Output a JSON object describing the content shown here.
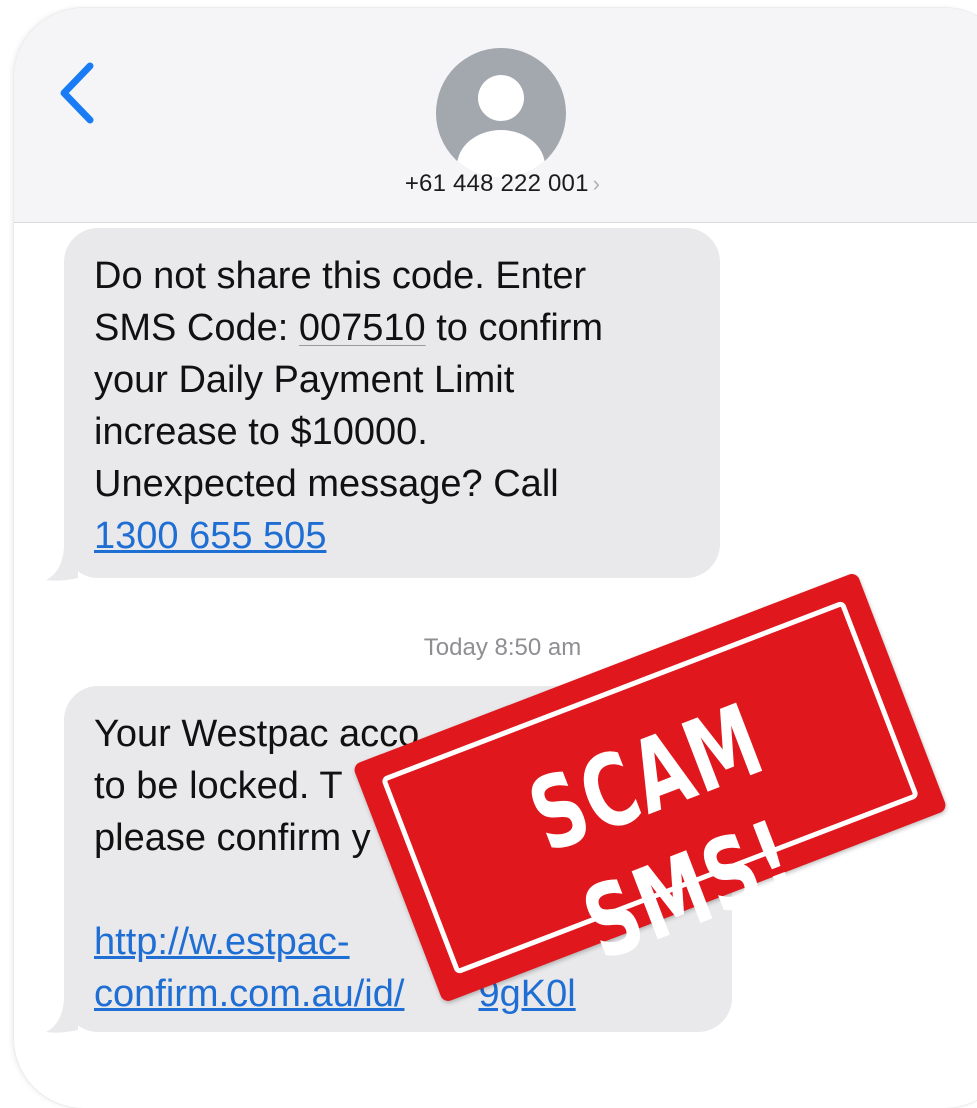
{
  "header": {
    "contact_number": "+61 448 222 001",
    "contact_chevron": "›"
  },
  "messages": [
    {
      "lines": [
        "Do not share this code. Enter",
        "SMS Code: ",
        "your Daily Payment Limit",
        "increase to $10000.",
        "Unexpected message? Call"
      ],
      "code": "007510",
      "after_code": " to confirm",
      "phone_link": "1300 655 505"
    },
    {
      "line1": "Your Westpac acco",
      "line2": "to be locked. T",
      "line3": "please confirm",
      "line3_tail": " y",
      "link_line1": "http://w.estpac-",
      "link_line2a": "confirm.com.au/id/",
      "link_line2b": "9gK0l"
    }
  ],
  "timestamp": "Today 8:50 am",
  "stamp": {
    "text": "SCAM SMS!",
    "color": "#e0171c"
  },
  "colors": {
    "bubble": "#e9e9eb",
    "link": "#1f6ed4",
    "back": "#1a7cf5"
  },
  "icons": {
    "back": "chevron-left-icon",
    "avatar": "person-avatar-icon"
  }
}
